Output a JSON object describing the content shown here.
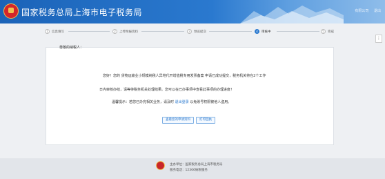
{
  "header": {
    "title": "国家税务总局上海市电子税务局",
    "company": "有限公司",
    "logout": "退出"
  },
  "steps": [
    {
      "num": "1",
      "label": "信息填写"
    },
    {
      "num": "2",
      "label": "上传附报资料"
    },
    {
      "num": "3",
      "label": "预览提交"
    },
    {
      "num": "4",
      "label": "审核中"
    },
    {
      "num": "5",
      "label": "完成"
    }
  ],
  "side_button": "⋮",
  "message": {
    "greeting": "尊敬的纳税人：",
    "line1": "您好！您的  货物运输业小规模纳税人异地代开增值税专用发票备案  申请已成功提交，税务机关将在2个工作",
    "line2": "日内审核办结，请等待税务机关处理结果。您可以在已办事项中查看此事项的办理进度！",
    "line3_prefix": "温馨提示：若您已办完相关业务，请及时",
    "line3_link": "退出登录",
    "line3_suffix": "以免账号权限被他人盗用。"
  },
  "buttons": {
    "view_submitted": "查看您的申请资料",
    "print_receipt": "打印回执"
  },
  "footer": {
    "sponsor": "主办单位：国家税务总局上海市税务局",
    "hotline": "服务电话：12366纳税服务"
  }
}
